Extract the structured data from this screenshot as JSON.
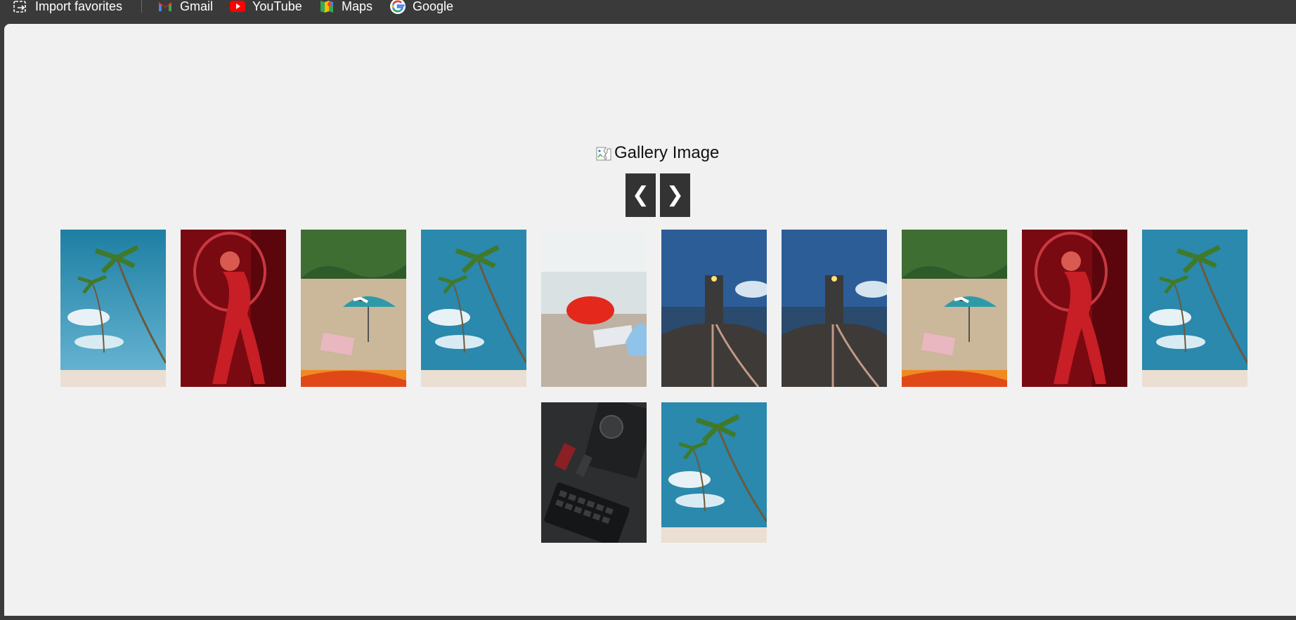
{
  "bookmarks": {
    "import_label": "Import favorites",
    "gmail_label": "Gmail",
    "youtube_label": "YouTube",
    "maps_label": "Maps",
    "google_label": "Google"
  },
  "gallery": {
    "main_image_alt": "Gallery Image",
    "prev_label": "❮",
    "next_label": "❯",
    "thumbnails": [
      {
        "subject": "palm-beach"
      },
      {
        "subject": "red-woman"
      },
      {
        "subject": "umbrella-beach"
      },
      {
        "subject": "palm-beach"
      },
      {
        "subject": "red-umbrella-pebbles"
      },
      {
        "subject": "lighthouse"
      },
      {
        "subject": "lighthouse"
      },
      {
        "subject": "umbrella-beach"
      },
      {
        "subject": "red-woman"
      },
      {
        "subject": "palm-beach"
      },
      {
        "subject": "laptop-parts"
      },
      {
        "subject": "palm-beach"
      }
    ]
  },
  "colors": {
    "bookmarks_bar_bg": "#3a3a3a",
    "page_bg": "#f1f1f1",
    "nav_button_bg": "#333333"
  }
}
